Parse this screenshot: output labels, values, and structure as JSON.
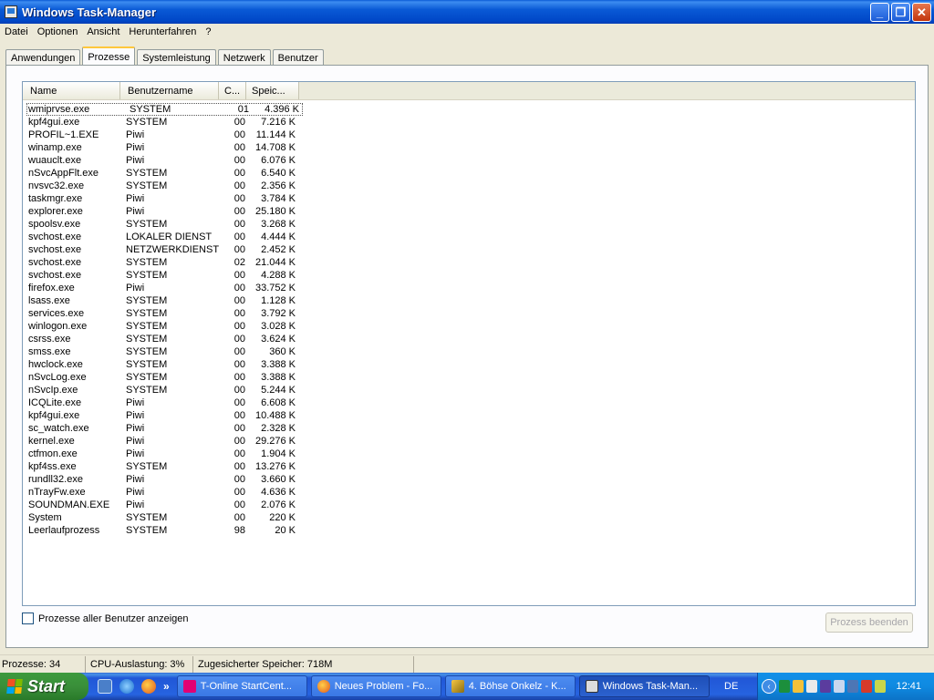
{
  "window": {
    "title": "Windows Task-Manager",
    "minimize_glyph": "_",
    "maximize_glyph": "❐",
    "close_glyph": "✕"
  },
  "menu": [
    "Datei",
    "Optionen",
    "Ansicht",
    "Herunterfahren",
    "?"
  ],
  "tabs": [
    {
      "label": "Anwendungen",
      "active": false
    },
    {
      "label": "Prozesse",
      "active": true
    },
    {
      "label": "Systemleistung",
      "active": false
    },
    {
      "label": "Netzwerk",
      "active": false
    },
    {
      "label": "Benutzer",
      "active": false
    }
  ],
  "process_list": {
    "columns": [
      "Name",
      "Benutzername",
      "C...",
      "Speic..."
    ],
    "rows": [
      [
        "wmiprvse.exe",
        "SYSTEM",
        "01",
        "4.396 K"
      ],
      [
        "kpf4gui.exe",
        "SYSTEM",
        "00",
        "7.216 K"
      ],
      [
        "PROFIL~1.EXE",
        "Piwi",
        "00",
        "11.144 K"
      ],
      [
        "winamp.exe",
        "Piwi",
        "00",
        "14.708 K"
      ],
      [
        "wuauclt.exe",
        "Piwi",
        "00",
        "6.076 K"
      ],
      [
        "nSvcAppFlt.exe",
        "SYSTEM",
        "00",
        "6.540 K"
      ],
      [
        "nvsvc32.exe",
        "SYSTEM",
        "00",
        "2.356 K"
      ],
      [
        "taskmgr.exe",
        "Piwi",
        "00",
        "3.784 K"
      ],
      [
        "explorer.exe",
        "Piwi",
        "00",
        "25.180 K"
      ],
      [
        "spoolsv.exe",
        "SYSTEM",
        "00",
        "3.268 K"
      ],
      [
        "svchost.exe",
        "LOKALER DIENST",
        "00",
        "4.444 K"
      ],
      [
        "svchost.exe",
        "NETZWERKDIENST",
        "00",
        "2.452 K"
      ],
      [
        "svchost.exe",
        "SYSTEM",
        "02",
        "21.044 K"
      ],
      [
        "svchost.exe",
        "SYSTEM",
        "00",
        "4.288 K"
      ],
      [
        "firefox.exe",
        "Piwi",
        "00",
        "33.752 K"
      ],
      [
        "lsass.exe",
        "SYSTEM",
        "00",
        "1.128 K"
      ],
      [
        "services.exe",
        "SYSTEM",
        "00",
        "3.792 K"
      ],
      [
        "winlogon.exe",
        "SYSTEM",
        "00",
        "3.028 K"
      ],
      [
        "csrss.exe",
        "SYSTEM",
        "00",
        "3.624 K"
      ],
      [
        "smss.exe",
        "SYSTEM",
        "00",
        "360 K"
      ],
      [
        "hwclock.exe",
        "SYSTEM",
        "00",
        "3.388 K"
      ],
      [
        "nSvcLog.exe",
        "SYSTEM",
        "00",
        "3.388 K"
      ],
      [
        "nSvcIp.exe",
        "SYSTEM",
        "00",
        "5.244 K"
      ],
      [
        "ICQLite.exe",
        "Piwi",
        "00",
        "6.608 K"
      ],
      [
        "kpf4gui.exe",
        "Piwi",
        "00",
        "10.488 K"
      ],
      [
        "sc_watch.exe",
        "Piwi",
        "00",
        "2.328 K"
      ],
      [
        "kernel.exe",
        "Piwi",
        "00",
        "29.276 K"
      ],
      [
        "ctfmon.exe",
        "Piwi",
        "00",
        "1.904 K"
      ],
      [
        "kpf4ss.exe",
        "SYSTEM",
        "00",
        "13.276 K"
      ],
      [
        "rundll32.exe",
        "Piwi",
        "00",
        "3.660 K"
      ],
      [
        "nTrayFw.exe",
        "Piwi",
        "00",
        "4.636 K"
      ],
      [
        "SOUNDMAN.EXE",
        "Piwi",
        "00",
        "2.076 K"
      ],
      [
        "System",
        "SYSTEM",
        "00",
        "220 K"
      ],
      [
        "Leerlaufprozess",
        "SYSTEM",
        "98",
        "20 K"
      ]
    ]
  },
  "show_all_users_label": "Prozesse aller Benutzer anzeigen",
  "end_process_label": "Prozess beenden",
  "status": {
    "processes": "Prozesse: 34",
    "cpu": "CPU-Auslastung: 3%",
    "memory": "Zugesicherter Speicher: 718M"
  },
  "taskbar": {
    "start_label": "Start",
    "quicklaunch_more": "»",
    "tasks": [
      {
        "label": "T-Online StartCent...",
        "icon": "tonline-icon",
        "active": false
      },
      {
        "label": "Neues Problem - Fo...",
        "icon": "firefox-icon",
        "active": false
      },
      {
        "label": "4. Böhse Onkelz - K...",
        "icon": "winamp-icon",
        "active": false
      },
      {
        "label": "Windows Task-Man...",
        "icon": "taskmanager-icon",
        "active": true
      }
    ],
    "language": "DE",
    "clock": "12:41"
  },
  "colors": {
    "titlebar": "#0a5ad6",
    "taskbar": "#2663e0",
    "start": "#3a8f3a",
    "tab_highlight": "#ffc73c"
  }
}
